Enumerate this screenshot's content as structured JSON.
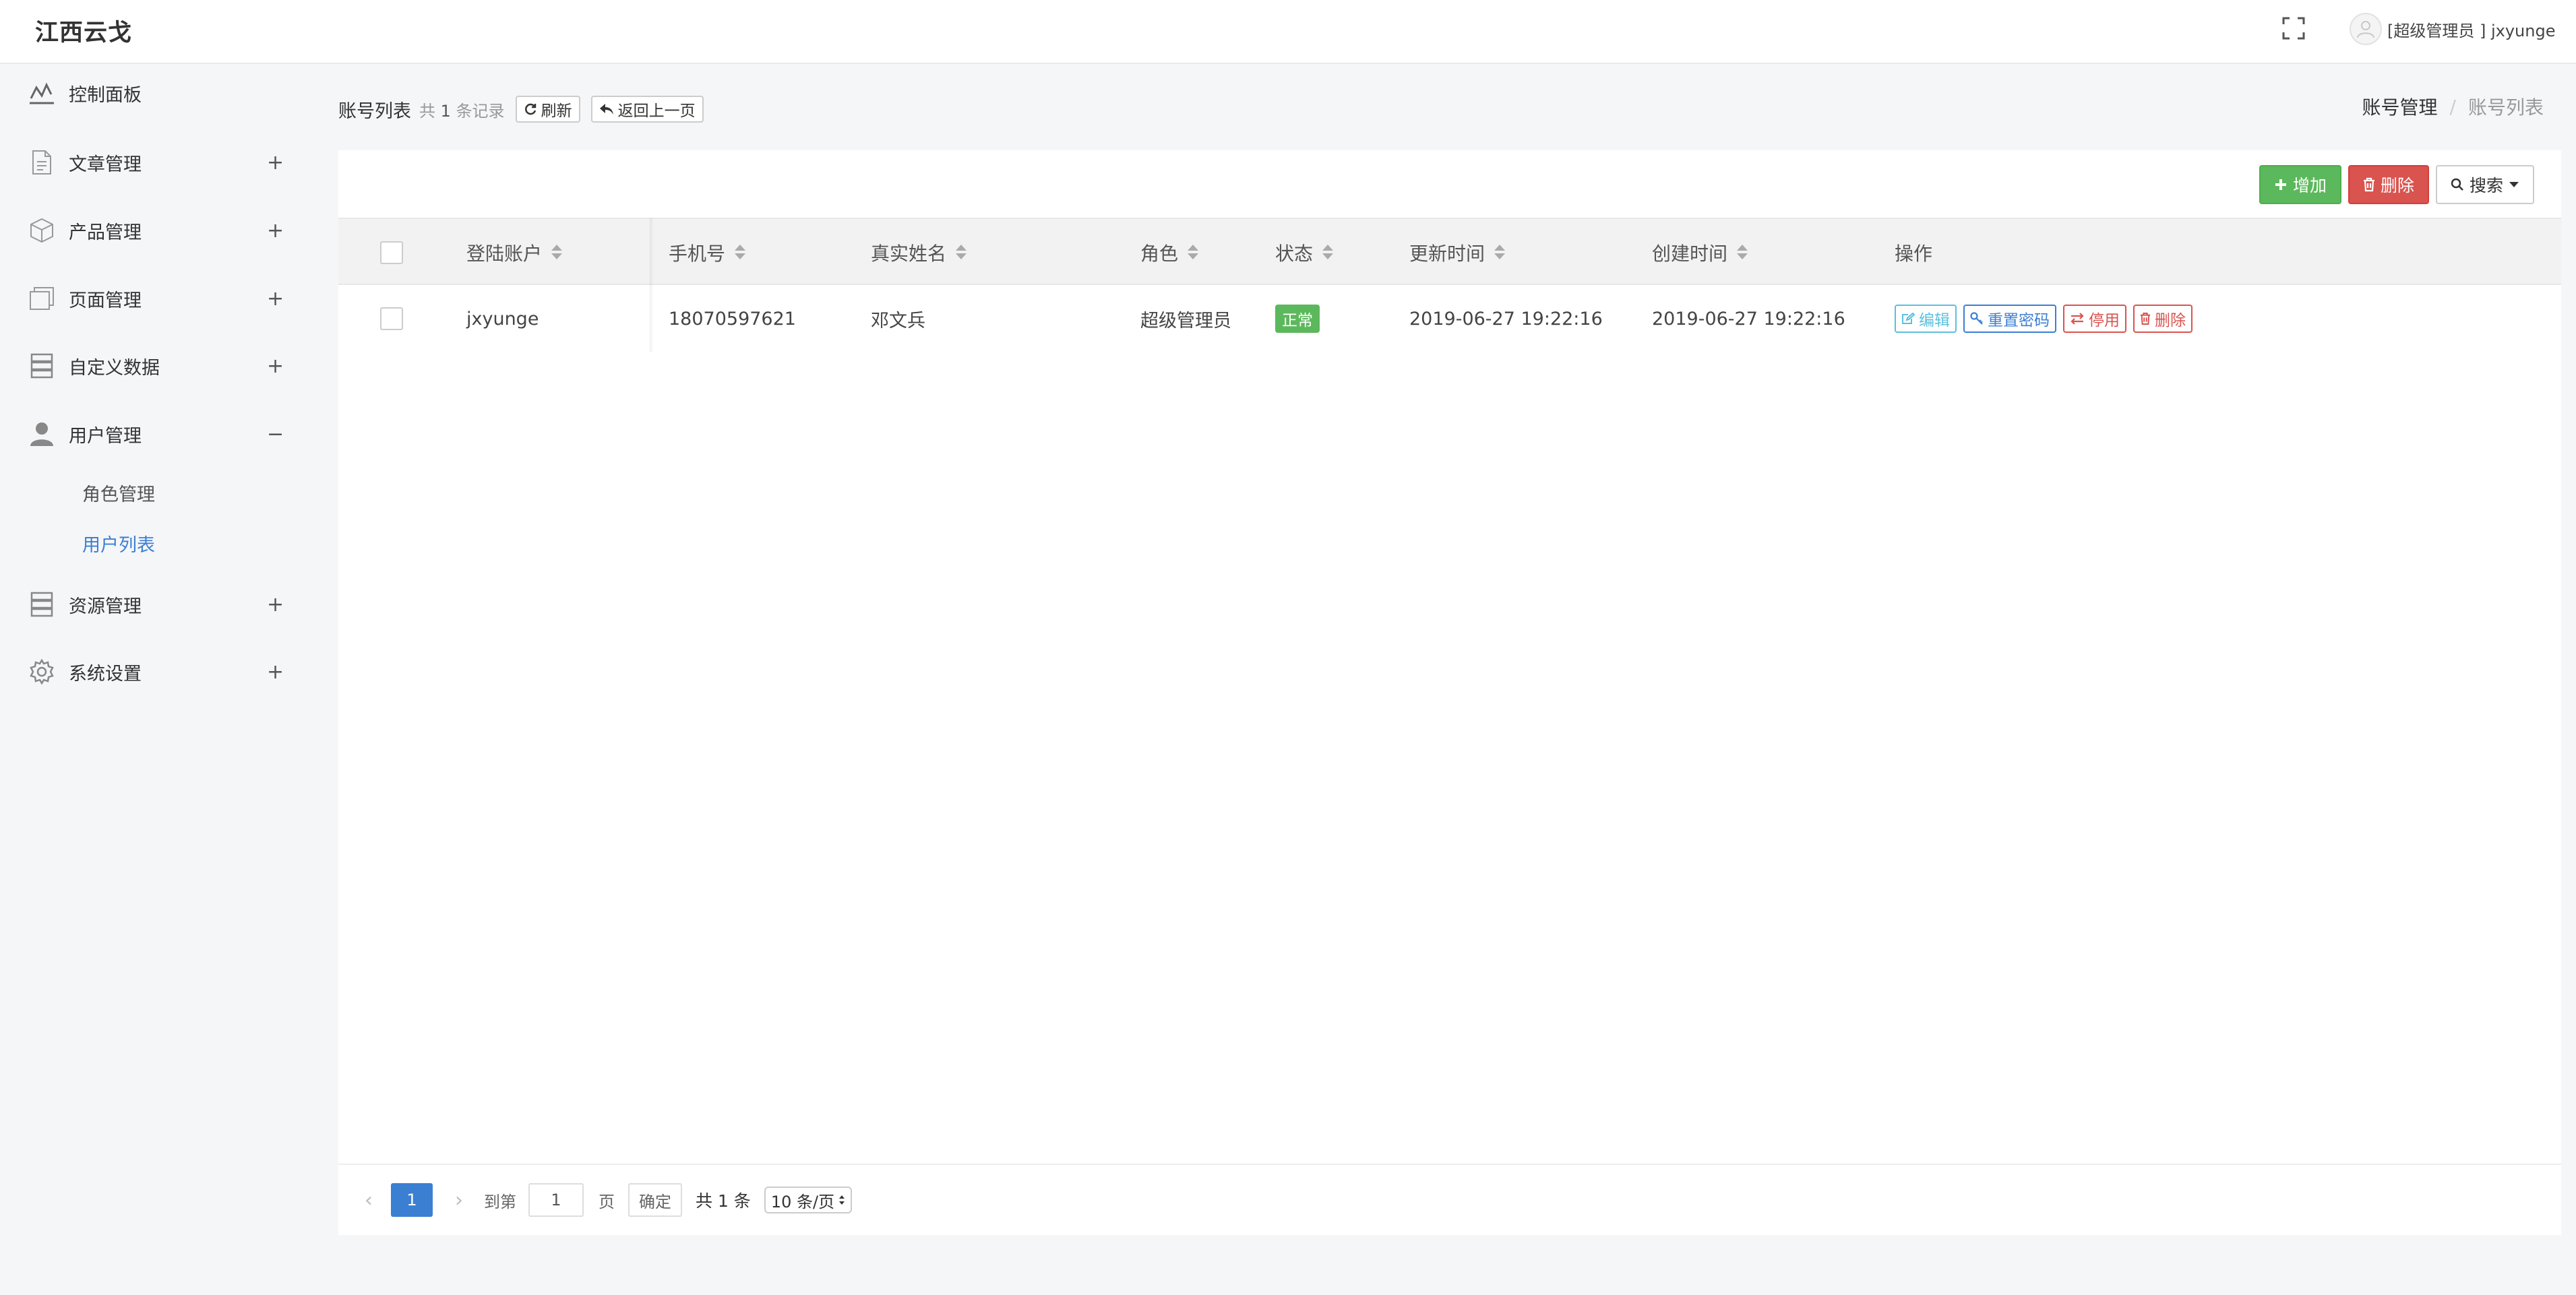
{
  "header": {
    "brand": "江西云戈",
    "fullscreen_icon": "fullscreen-icon",
    "user_label": "[超级管理员 ] jxyunge"
  },
  "sidebar": {
    "items": [
      {
        "label": "控制面板",
        "icon": "dashboard-icon",
        "toggle": ""
      },
      {
        "label": "文章管理",
        "icon": "document-icon",
        "toggle": "+"
      },
      {
        "label": "产品管理",
        "icon": "box-icon",
        "toggle": "+"
      },
      {
        "label": "页面管理",
        "icon": "pages-icon",
        "toggle": "+"
      },
      {
        "label": "自定义数据",
        "icon": "database-icon",
        "toggle": "+"
      },
      {
        "label": "用户管理",
        "icon": "user-icon",
        "toggle": "−"
      },
      {
        "label": "资源管理",
        "icon": "server-icon",
        "toggle": "+"
      },
      {
        "label": "系统设置",
        "icon": "gear-icon",
        "toggle": "+"
      }
    ],
    "sub_items": [
      {
        "label": "角色管理",
        "active": false
      },
      {
        "label": "用户列表",
        "active": true
      }
    ]
  },
  "page": {
    "title": "账号列表",
    "count_prefix": "共",
    "count": "1",
    "count_suffix": "条记录",
    "refresh_label": "刷新",
    "back_label": "返回上一页",
    "breadcrumb": [
      "账号管理",
      "账号列表"
    ],
    "breadcrumb_sep": "/"
  },
  "toolbar": {
    "add_label": "增加",
    "delete_label": "删除",
    "search_label": "搜索"
  },
  "table": {
    "columns": [
      "登陆账户",
      "手机号",
      "真实姓名",
      "角色",
      "状态",
      "更新时间",
      "创建时间",
      "操作"
    ],
    "rows": [
      {
        "account": "jxyunge",
        "phone": "18070597621",
        "real_name": "邓文兵",
        "role": "超级管理员",
        "status": "正常",
        "updated": "2019-06-27 19:22:16",
        "created": "2019-06-27 19:22:16",
        "actions": [
          "编辑",
          "重置密码",
          "停用",
          "删除"
        ]
      }
    ]
  },
  "pagination": {
    "current_page": "1",
    "goto_label": "到第",
    "goto_value": "1",
    "page_label": "页",
    "confirm_label": "确定",
    "total_label": "共 1 条",
    "page_size": "10 条/页"
  },
  "colors": {
    "accent": "#3b7fd3",
    "success": "#5cb85c",
    "danger": "#d9534f",
    "info": "#5bc0de"
  }
}
